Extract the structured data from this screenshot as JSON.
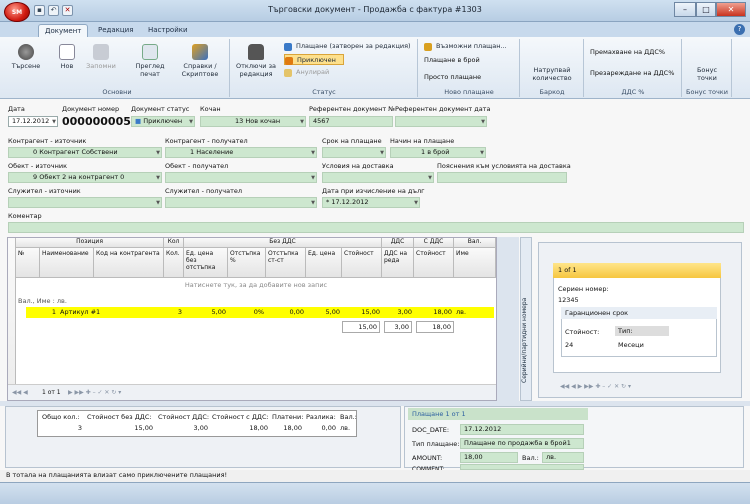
{
  "window": {
    "title": "Търговски документ - Продажба с фактура #1303",
    "orb_label": "SM"
  },
  "quick_access": [
    "save",
    "undo",
    "close"
  ],
  "tabs": [
    {
      "label": "Документ",
      "active": true
    },
    {
      "label": "Редакция"
    },
    {
      "label": "Настройки"
    }
  ],
  "ribbon": {
    "groups": {
      "basic": "Основни",
      "status": "Статус",
      "new_payment": "Ново плащане",
      "barcode": "Баркод",
      "vat": "ДДС %",
      "bonus": "Бонус точки"
    },
    "search": "Търсене",
    "new": "Нов",
    "save": "Запомни",
    "preview": "Преглед печат",
    "reports": "Справки / Скриптове",
    "unlock": "Отключи за редакция",
    "payment_locked": "Плащане (затворен за редакция)",
    "confirmed": "Приключен",
    "cancelled": "Анулирай",
    "possible_payments": "Възможни плащан...",
    "pay_in_cash": "Плащане в брой",
    "simple_payment": "Просто плащане",
    "increment_qty": "Натрупвай количество",
    "remove_vat": "Премахване на ДДС%",
    "recharge_vat": "Презареждане на ДДС%",
    "bonus_points": "Бонус точки"
  },
  "header": {
    "date_label": "Дата",
    "date": "17.12.2012",
    "docnum_label": "Документ номер",
    "docnum": "0000000058",
    "status_label": "Документ статус",
    "status": "Приключен",
    "session_label": "Кочан",
    "session": "13 Нов кочан",
    "refdoc_label": "Референтен документ №",
    "refdoc": "4567",
    "refdate_label": "Референтен документ дата"
  },
  "fields": {
    "source_partner_label": "Контрагент - източник",
    "source_partner": "0 Контрагент Собствени",
    "target_partner_label": "Контрагент - получател",
    "target_partner": "1 Население",
    "payment_term_label": "Срок на плащане",
    "payment_method_label": "Начин на плащане",
    "payment_method": "1 в брой",
    "source_object_label": "Обект - източник",
    "source_object": "9 Обект 2 на контрагент 0",
    "target_object_label": "Обект - получател",
    "delivery_terms_label": "Условия на доставка",
    "delivery_notes_label": "Пояснения към условията на доставка",
    "source_employee_label": "Служител - източник",
    "target_employee_label": "Служител - получател",
    "due_date_label": "Дата при изчисление на дълг",
    "due_date": "* 17.12.2012",
    "comment_label": "Коментар"
  },
  "grid": {
    "band_headers": {
      "position": "Позиция",
      "qty": "Кол",
      "novat": "Без ДДС",
      "vat": "ДДС",
      "withvat": "С ДДС",
      "currency": "Вал."
    },
    "columns": [
      "№",
      "Наименование",
      "Код на контрагента",
      "Кол.",
      "Ед. цена без отстъпка",
      "Отстъпка %",
      "Отстъпка ст-ст",
      "Ед. цена",
      "Стойност",
      "ДДС на реда",
      "Стойност",
      "Име"
    ],
    "group_row": "Вал., Име : лв.",
    "new_row": "Натиснете тук, за да добавите нов запис",
    "rows": [
      {
        "num": "1",
        "name": "Артикул #1",
        "code": "",
        "qty": "3",
        "unit_price_nodisc": "5,00",
        "disc_pct": "0%",
        "disc_val": "0,00",
        "unit_price": "5,00",
        "value": "15,00",
        "vat": "3,00",
        "total": "18,00",
        "cur": "лв."
      }
    ],
    "totals": {
      "value": "15,00",
      "vat": "3,00",
      "total": "18,00"
    },
    "pager": "1 от 1"
  },
  "serial_panel": {
    "tab_label": "Серийни/партидни номера",
    "card_header": "1 of 1",
    "serial_label": "Сериен номер:",
    "serial": "12345",
    "warranty_header": "Гаранционен срок",
    "value_label": "Стойност:",
    "type_label": "Тип:",
    "value": "24",
    "type": "Месеци"
  },
  "summary": {
    "headers": [
      "Общо кол.:",
      "Стойност без ДДС:",
      "Стойност ДДС:",
      "Стойност с ДДС:",
      "Платени:",
      "Разлика:",
      "Вал.:"
    ],
    "values": [
      "3",
      "15,00",
      "3,00",
      "18,00",
      "18,00",
      "0,00",
      "лв."
    ]
  },
  "payment": {
    "header": "Плащане 1 от 1",
    "doc_date_label": "DOC_DATE:",
    "doc_date": "17.12.2012",
    "type_label": "Тип плащане:",
    "type": "Плащане по продажба в брой1",
    "amount_label": "AMOUNT:",
    "amount": "18,00",
    "cur_label": "Вал.:",
    "cur": "лв.",
    "comment_label": "COMMENT:"
  },
  "status_text": "В тотала на плащанията влизат само приключените плащания!",
  "colors": {
    "field_green": "#cde7cf",
    "highlight_row": "#ffff00",
    "ribbon": "#dde7f2",
    "titlebar": "#b7cde3"
  }
}
